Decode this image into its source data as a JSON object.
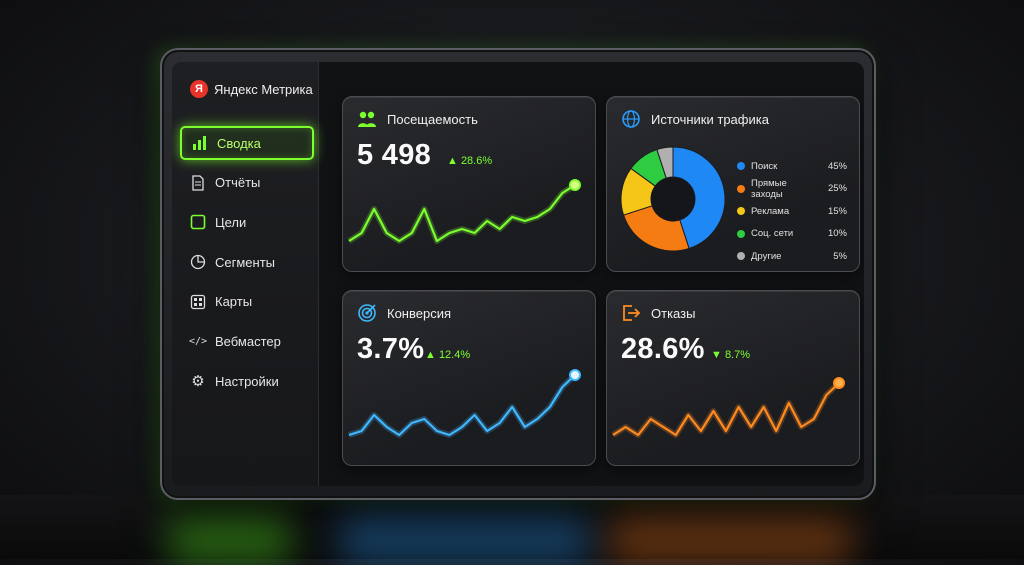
{
  "brand": {
    "name": "Яндекс Метрика",
    "logo_letter": "Я"
  },
  "sidebar": {
    "items": [
      {
        "label": "Сводка",
        "icon": "bar-chart-icon",
        "active": true
      },
      {
        "label": "Отчёты",
        "icon": "document-icon",
        "active": false
      },
      {
        "label": "Цели",
        "icon": "target-square-icon",
        "active": false
      },
      {
        "label": "Сегменты",
        "icon": "pie-segment-icon",
        "active": false
      },
      {
        "label": "Карты",
        "icon": "grid-icon",
        "active": false
      },
      {
        "label": "Вебмастер",
        "icon": "code-icon",
        "active": false
      },
      {
        "label": "Настройки",
        "icon": "gear-icon",
        "active": false
      }
    ]
  },
  "widgets": {
    "visits": {
      "title": "Посещаемость",
      "value": "5 498",
      "delta": "▲ 28.6%",
      "color": "#7cff2e",
      "icon": "users-icon"
    },
    "sources": {
      "title": "Источники трафика",
      "icon": "globe-icon",
      "legend": [
        {
          "name": "Поиск",
          "value": "45%",
          "color": "#1e88f5"
        },
        {
          "name": "Прямые заходы",
          "value": "25%",
          "color": "#f57c12"
        },
        {
          "name": "Реклама",
          "value": "15%",
          "color": "#f5c518"
        },
        {
          "name": "Соц. сети",
          "value": "10%",
          "color": "#2ecc40"
        },
        {
          "name": "Другие",
          "value": "5%",
          "color": "#b0b0b0"
        }
      ]
    },
    "conversion": {
      "title": "Конверсия",
      "value": "3.7%",
      "delta": "▲ 12.4%",
      "color": "#3fb8ff",
      "icon": "target-icon"
    },
    "bounces": {
      "title": "Отказы",
      "value": "28.6%",
      "delta": "▼ 8.7%",
      "color": "#ff8a1f",
      "icon": "exit-icon"
    }
  },
  "chart_data": [
    {
      "type": "line",
      "series": [
        {
          "values": [
            2,
            3,
            6,
            3,
            2,
            3,
            6,
            2,
            3,
            3.5,
            3,
            4.5,
            3.5,
            5,
            4.5,
            5,
            6,
            8,
            9
          ]
        }
      ]
    },
    {
      "type": "pie",
      "categories": [
        "Поиск",
        "Прямые заходы",
        "Реклама",
        "Соц. сети",
        "Другие"
      ],
      "values": [
        45,
        25,
        15,
        10,
        5
      ]
    },
    {
      "type": "line",
      "series": [
        {
          "values": [
            2,
            2.5,
            4.5,
            3,
            2,
            3.5,
            4,
            2.5,
            2,
            3,
            4.5,
            2.5,
            3.5,
            5.5,
            3,
            4,
            5.5,
            8,
            9.5
          ]
        }
      ]
    },
    {
      "type": "line",
      "series": [
        {
          "values": [
            2,
            3,
            2,
            4,
            3,
            2,
            4.5,
            2.5,
            5,
            2.5,
            5.5,
            3,
            5.5,
            2.5,
            6,
            3,
            4,
            7,
            8.5
          ]
        }
      ]
    }
  ]
}
